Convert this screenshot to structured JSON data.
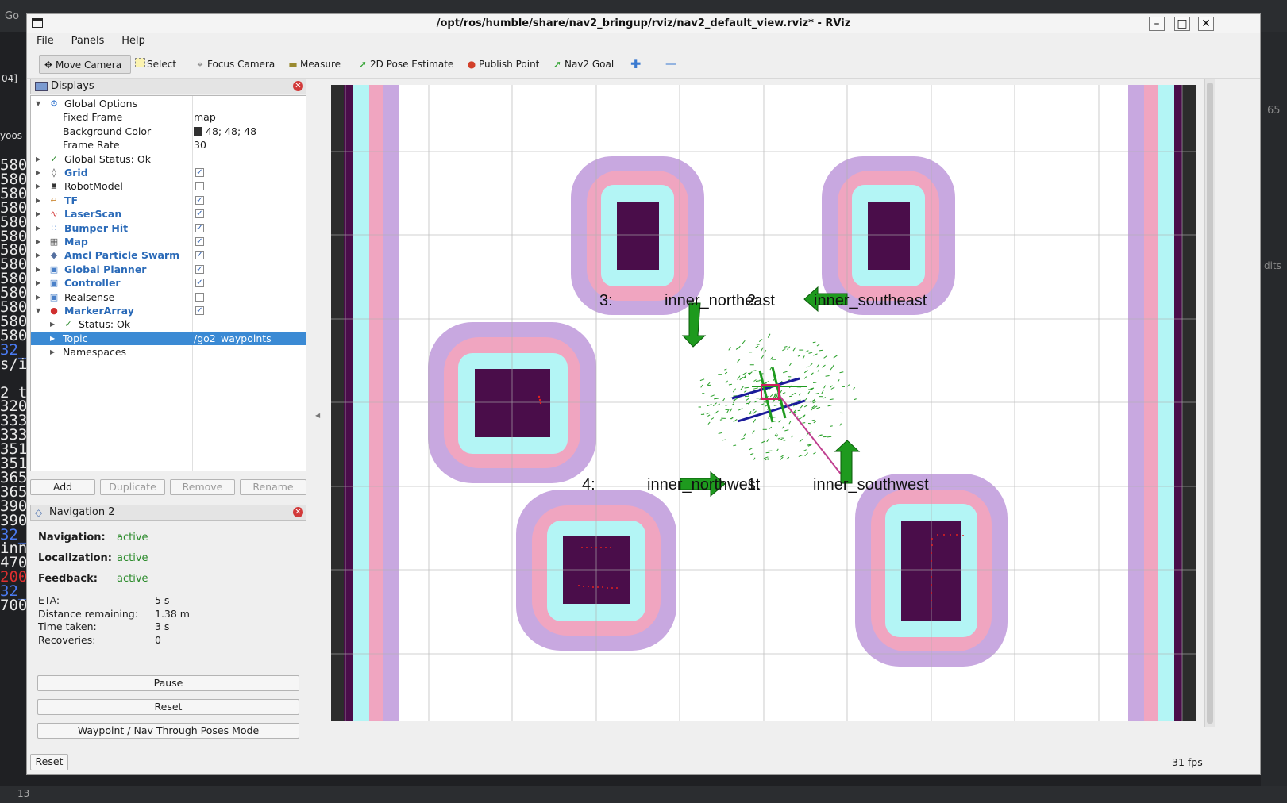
{
  "window": {
    "title": "/opt/ros/humble/share/nav2_bringup/rviz/nav2_default_view.rviz* - RViz"
  },
  "menu": {
    "file": "File",
    "panels": "Panels",
    "help": "Help"
  },
  "toolbar": {
    "move_camera": "Move Camera",
    "select": "Select",
    "focus_camera": "Focus Camera",
    "measure": "Measure",
    "pose_estimate": "2D Pose Estimate",
    "publish_point": "Publish Point",
    "nav2_goal": "Nav2 Goal"
  },
  "displays": {
    "title": "Displays",
    "global_options": "Global Options",
    "fixed_frame_label": "Fixed Frame",
    "fixed_frame_value": "map",
    "bg_color_label": "Background Color",
    "bg_color_value": "48; 48; 48",
    "frame_rate_label": "Frame Rate",
    "frame_rate_value": "30",
    "global_status": "Global Status: Ok",
    "items": [
      {
        "label": "Grid",
        "checked": true
      },
      {
        "label": "RobotModel",
        "checked": false
      },
      {
        "label": "TF",
        "checked": true
      },
      {
        "label": "LaserScan",
        "checked": true
      },
      {
        "label": "Bumper Hit",
        "checked": true
      },
      {
        "label": "Map",
        "checked": true
      },
      {
        "label": "Amcl Particle Swarm",
        "checked": true
      },
      {
        "label": "Global Planner",
        "checked": true
      },
      {
        "label": "Controller",
        "checked": true
      },
      {
        "label": "Realsense",
        "checked": false
      },
      {
        "label": "MarkerArray",
        "checked": true
      }
    ],
    "status_ok": "Status: Ok",
    "topic_label": "Topic",
    "topic_value": "/go2_waypoints",
    "namespaces": "Namespaces",
    "add": "Add",
    "duplicate": "Duplicate",
    "remove": "Remove",
    "rename": "Rename"
  },
  "nav2": {
    "title": "Navigation 2",
    "navigation_label": "Navigation:",
    "navigation_value": "active",
    "localization_label": "Localization:",
    "localization_value": "active",
    "feedback_label": "Feedback:",
    "feedback_value": "active",
    "eta_label": "ETA:",
    "eta_value": "5 s",
    "distance_label": "Distance remaining:",
    "distance_value": "1.38 m",
    "time_label": "Time taken:",
    "time_value": "3 s",
    "recoveries_label": "Recoveries:",
    "recoveries_value": "0",
    "pause": "Pause",
    "reset": "Reset",
    "mode": "Waypoint / Nav Through Poses Mode"
  },
  "status": {
    "reset": "Reset",
    "fps": "31 fps"
  },
  "view": {
    "labels": [
      {
        "text": "3:"
      },
      {
        "text": "inner_northeast"
      },
      {
        "text": "2:"
      },
      {
        "text": "inner_southeast"
      },
      {
        "text": "4:"
      },
      {
        "text": "inner_northwest"
      },
      {
        "text": "1:"
      },
      {
        "text": "inner_southwest"
      }
    ]
  },
  "background": {
    "terminal_lines": [
      "580.",
      "580.",
      "580.",
      "580.",
      "580.",
      "580.",
      "580.",
      "580.",
      "580.",
      "580.",
      "580.",
      "580.",
      "580.",
      "32_w",
      "s/in",
      "",
      "2_t",
      "320.",
      "333.",
      "333.",
      "351.",
      "351.",
      "365.",
      "365.",
      "390.",
      "390.",
      "32_w",
      "inne",
      "470",
      "200",
      "32_w",
      "700."
    ],
    "top_left": "Go",
    "line_04": "04]",
    "user": "yoos",
    "bottom_count": "13",
    "right_num": "65",
    "right_text": "dits"
  },
  "colors": {
    "selection": "#3b8ad4",
    "active_green": "#2a8a2a",
    "obstacle": "#4a0d4a",
    "inflation_cyan": "#b3f5f5",
    "inflation_pink": "#f0a5c0",
    "inflation_lavender": "#c8a8e0",
    "arrow_green": "#1e9a1e"
  }
}
